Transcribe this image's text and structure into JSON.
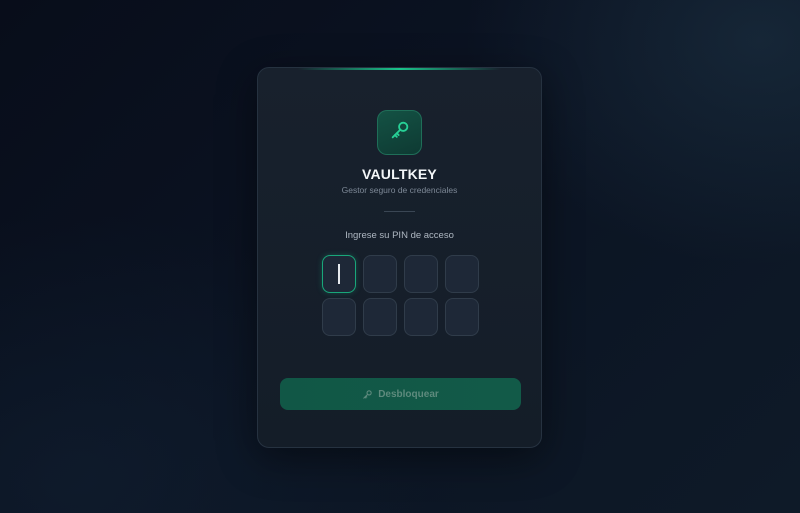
{
  "app": {
    "title": "VAULTKEY",
    "subtitle": "Gestor seguro de credenciales",
    "logo_icon": "key-icon"
  },
  "pin": {
    "prompt": "Ingrese su PIN de acceso",
    "length": 8,
    "filled": 0,
    "active_index": 0
  },
  "actions": {
    "unlock_label": "Desbloquear",
    "unlock_icon": "key-icon",
    "unlock_enabled": false
  },
  "colors": {
    "accent": "#19c48b",
    "background": "#0b1322",
    "card": "#18212d",
    "button": "#115746"
  }
}
